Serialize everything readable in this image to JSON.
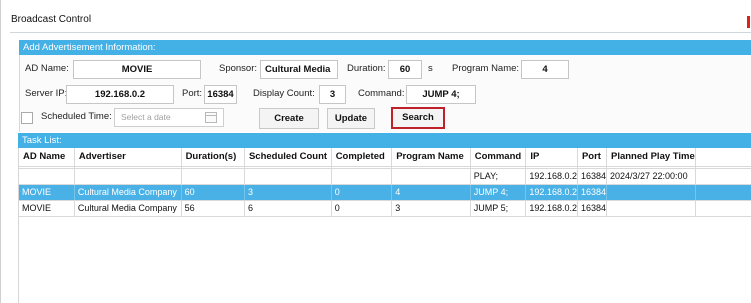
{
  "window": {
    "title": "Broadcast Control"
  },
  "add_section": {
    "header": "Add Advertisement Information:",
    "ad_name_label": "AD Name:",
    "ad_name_value": "MOVIE",
    "sponsor_label": "Sponsor:",
    "sponsor_value": "Cultural Media",
    "duration_label": "Duration:",
    "duration_value": "60",
    "duration_unit": "s",
    "program_name_label": "Program Name:",
    "program_name_value": "4",
    "server_ip_label": "Server IP:",
    "server_ip_value": "192.168.0.2",
    "port_label": "Port:",
    "port_value": "16384",
    "display_count_label": "Display Count:",
    "display_count_value": "3",
    "command_label": "Command:",
    "command_value": "JUMP 4;",
    "scheduled_time_label": "Scheduled Time:",
    "scheduled_time_placeholder": "Select a date",
    "create_label": "Create",
    "update_label": "Update",
    "search_label": "Search"
  },
  "task_list": {
    "header": "Task List:",
    "columns": [
      "AD Name",
      "Advertiser",
      "Duration(s)",
      "Scheduled Count",
      "Completed",
      "Program Name",
      "Command",
      "IP",
      "Port",
      "Planned Play Time"
    ],
    "rows": [
      [
        "",
        "",
        "",
        "",
        "",
        "",
        "PLAY;",
        "192.168.0.2",
        "16384",
        "2024/3/27 22:00:00"
      ],
      [
        "MOVIE",
        "Cultural Media Company",
        "60",
        "3",
        "0",
        "4",
        "JUMP 4;",
        "192.168.0.2",
        "16384",
        ""
      ],
      [
        "MOVIE",
        "Cultural Media Company",
        "56",
        "6",
        "0",
        "3",
        "JUMP 5;",
        "192.168.0.2",
        "16384",
        ""
      ]
    ],
    "selected_row": 1
  },
  "colors": {
    "accent": "#43b0e6",
    "selected_row": "#4ab1e6",
    "search_outline": "#c0202a"
  }
}
